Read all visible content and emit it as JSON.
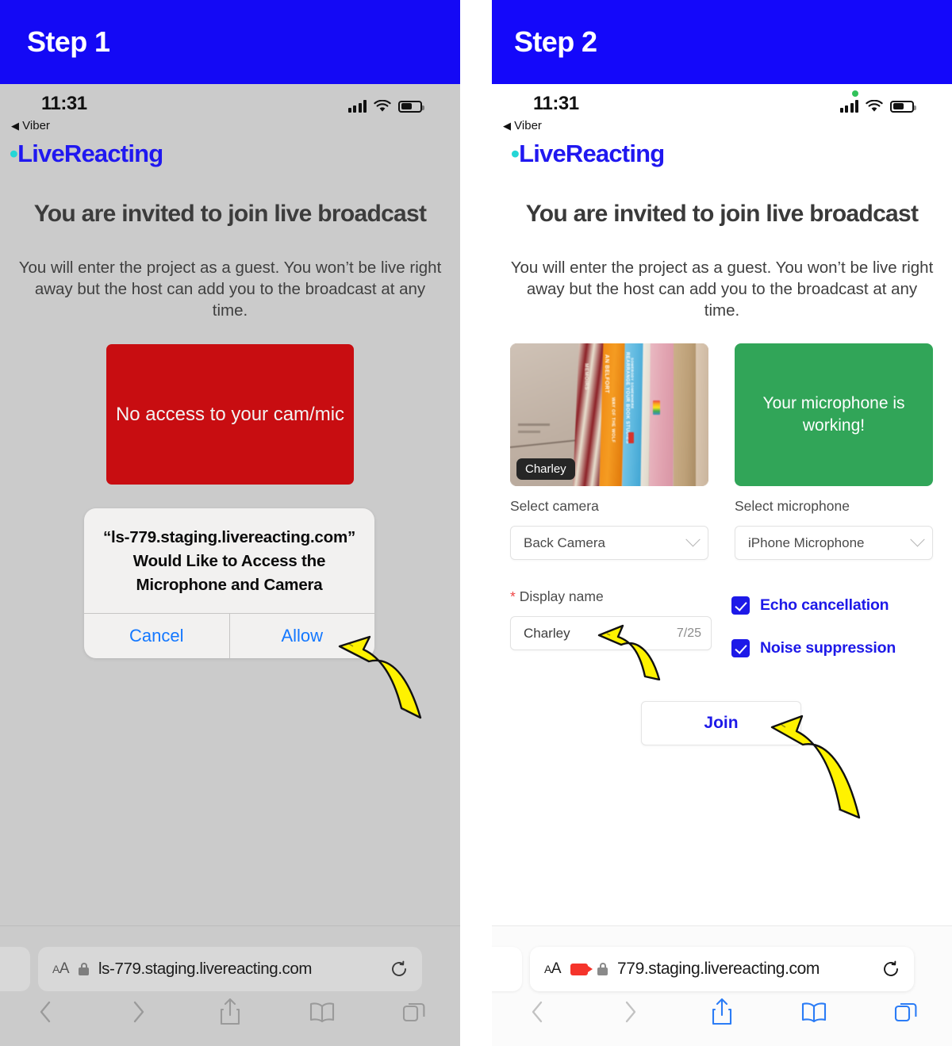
{
  "theme": {
    "banner_blue": "#1409f5",
    "brand_blue": "#2018f0",
    "brand_dot_cyan": "#24d6d6",
    "danger_red": "#c80d11",
    "success_green": "#31a558",
    "ios_link_blue": "#1478ff",
    "panel1_bg": "#cbcbcb",
    "panel2_bg": "#ffffff",
    "arrow_yellow": "#fff200"
  },
  "panels": [
    {
      "step_label": "Step 1",
      "status": {
        "time": "11:31",
        "back_app": "◀ Viber",
        "back_arrow": "◀",
        "back_label": "Viber",
        "privacy_dot": false
      },
      "brand": {
        "dot": "•",
        "name": "LiveReacting"
      },
      "headline": "You are invited to join live broadcast",
      "subtext": "You will enter the project as a guest. You won’t be live right away but the host can add you to the broadcast at any time.",
      "red_block": "No access to your cam/mic",
      "dialog": {
        "message": "“ls-779.staging.livereacting.com” Would Like to Access the Microphone and Camera",
        "cancel": "Cancel",
        "allow": "Allow"
      },
      "safari": {
        "aa_label": "AA",
        "url": "ls-779.staging.livereacting.com",
        "lock_icon": "lock-icon",
        "reload_icon": "reload-icon",
        "camera_recording": false,
        "tabs": [
          "back-icon",
          "forward-icon",
          "share-icon",
          "bookmarks-icon",
          "tabs-icon"
        ]
      }
    },
    {
      "step_label": "Step 2",
      "status": {
        "time": "11:31",
        "back_app": "◀ Viber",
        "back_arrow": "◀",
        "back_label": "Viber",
        "privacy_dot": true
      },
      "brand": {
        "dot": "•",
        "name": "LiveReacting"
      },
      "headline": "You are invited to join live broadcast",
      "subtext": "You will enter the project as a guest. You won’t be live right away but the host can add you to the broadcast at any time.",
      "camera_preview": {
        "name_badge": "Charley"
      },
      "mic_status": "Your microphone is working!",
      "fields": {
        "camera_label": "Select camera",
        "camera_value": "Back Camera",
        "mic_label": "Select microphone",
        "mic_value": "iPhone Microphone",
        "display_name_star": "*",
        "display_name_label": "Display name",
        "display_name_value": "Charley",
        "display_name_counter": "7/25"
      },
      "checkboxes": [
        {
          "label": "Echo cancellation",
          "checked": true
        },
        {
          "label": "Noise suppression",
          "checked": true
        }
      ],
      "join_button": "Join",
      "safari": {
        "aa_label": "AA",
        "url": "779.staging.livereacting.com",
        "lock_icon": "lock-icon",
        "reload_icon": "reload-icon",
        "camera_recording": true,
        "tabs": [
          "back-icon",
          "forward-icon",
          "share-icon",
          "bookmarks-icon",
          "tabs-icon"
        ]
      }
    }
  ],
  "annotations": [
    {
      "name": "arrow-pointing-to-allow",
      "points_to": "Allow"
    },
    {
      "name": "arrow-pointing-to-display-name",
      "points_to": "Display name"
    },
    {
      "name": "arrow-pointing-to-join",
      "points_to": "Join"
    }
  ]
}
